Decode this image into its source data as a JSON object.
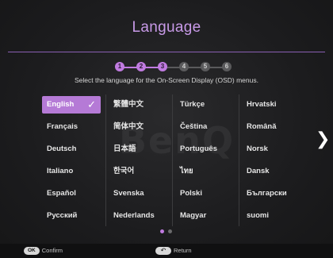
{
  "header": {
    "title": "Language",
    "subtitle": "Select the language for the On-Screen Display (OSD) menus."
  },
  "progress": {
    "steps": [
      "1",
      "2",
      "3",
      "4",
      "5",
      "6"
    ],
    "current_step": 3
  },
  "languages": {
    "columns": [
      [
        "English",
        "Français",
        "Deutsch",
        "Italiano",
        "Español",
        "Русский"
      ],
      [
        "繁體中文",
        "简体中文",
        "日本語",
        "한국어",
        "ไทย",
        "Svenska",
        "Nederlands"
      ],
      [
        "Türkçe",
        "Čeština",
        "Português",
        "ไทย",
        "Polski",
        "Magyar"
      ],
      [
        "Hrvatski",
        "Română",
        "Norsk",
        "Dansk",
        "Български",
        "suomi"
      ]
    ],
    "selected": "English"
  },
  "watermark": "BenQ",
  "pagination": {
    "pages": 2,
    "current": 1
  },
  "footer": {
    "confirm_key": "OK",
    "confirm_label": "Confirm",
    "return_label": "Return"
  },
  "colors": {
    "accent": "#c07be0",
    "selected_bg": "#b57ad6",
    "title": "#c89ae8"
  }
}
